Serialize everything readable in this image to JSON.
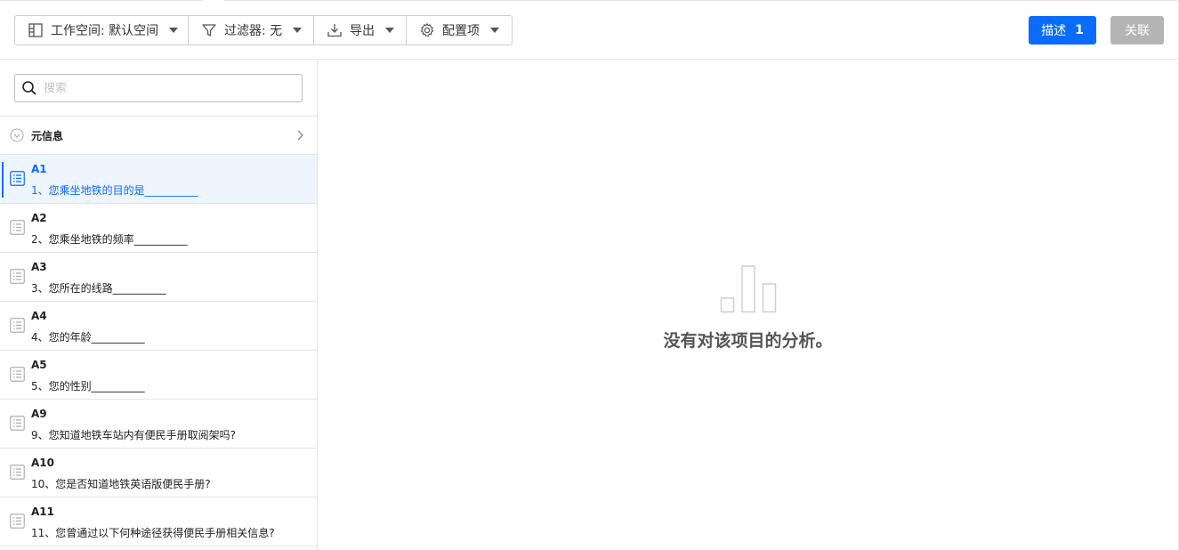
{
  "toolbar": {
    "workspace_label": "工作空间: 默认空间",
    "filter_label": "过滤器: 无",
    "export_label": "导出",
    "config_label": "配置项",
    "describe_label": "描述",
    "describe_count": "1",
    "associate_label": "关联"
  },
  "sidebar": {
    "search_placeholder": "搜索",
    "meta_label": "元信息",
    "items": [
      {
        "code": "A1",
        "text": "1、您乘坐地铁的目的是__________"
      },
      {
        "code": "A2",
        "text": "2、您乘坐地铁的频率__________"
      },
      {
        "code": "A3",
        "text": "3、您所在的线路__________"
      },
      {
        "code": "A4",
        "text": "4、您的年龄__________"
      },
      {
        "code": "A5",
        "text": "5、您的性别__________"
      },
      {
        "code": "A9",
        "text": "9、您知道地铁车站内有便民手册取阅架吗?"
      },
      {
        "code": "A10",
        "text": "10、您是否知道地铁英语版便民手册?"
      },
      {
        "code": "A11",
        "text": "11、您曾通过以下何种途径获得便民手册相关信息?"
      }
    ]
  },
  "main": {
    "empty_message": "没有对该项目的分析。"
  },
  "colors": {
    "accent": "#0a6cff",
    "disabled": "#b4b4b4",
    "active_bg": "#eef5ff"
  }
}
